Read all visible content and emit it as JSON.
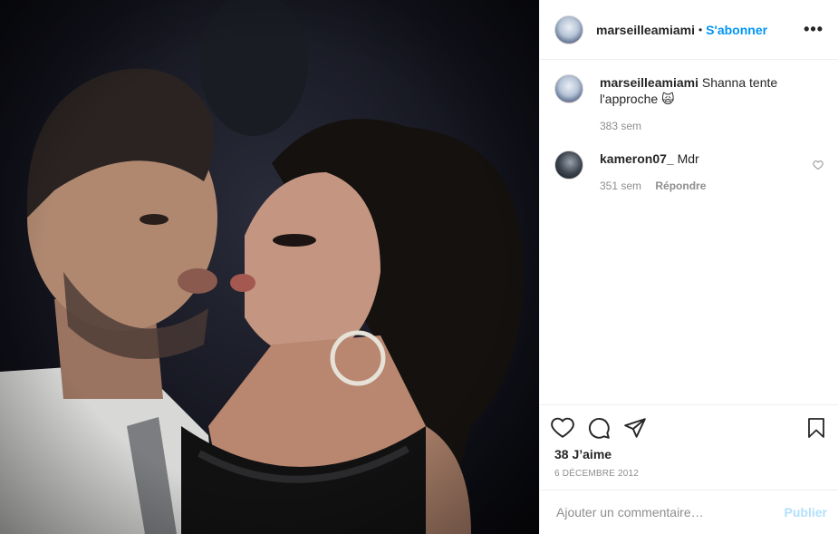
{
  "header": {
    "username": "marseilleamiami",
    "separator": "•",
    "follow_label": "S'abonner",
    "more_label": "•••"
  },
  "caption": {
    "username": "marseilleamiami",
    "text": "Shanna tente l'approche 🙀",
    "age": "383 sem"
  },
  "comments": [
    {
      "username": "kameron07_",
      "text": "Mdr",
      "age": "351 sem",
      "reply_label": "Répondre"
    }
  ],
  "actions": {
    "like_icon": "heart-icon",
    "comment_icon": "comment-icon",
    "share_icon": "share-icon",
    "save_icon": "bookmark-icon"
  },
  "likes": "38 J’aime",
  "date": "6 DÉCEMBRE 2012",
  "add_comment": {
    "placeholder": "Ajouter un commentaire…",
    "publish_label": "Publier"
  },
  "colors": {
    "accent": "#0095f6",
    "publish_disabled": "#b2dffc",
    "muted": "#8e8e8e",
    "text": "#262626"
  }
}
